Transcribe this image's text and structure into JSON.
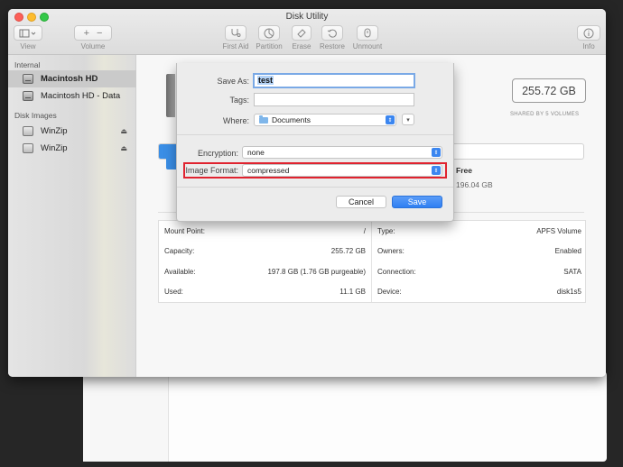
{
  "window": {
    "title": "Disk Utility"
  },
  "toolbar": {
    "view_label": "View",
    "volume_label": "Volume",
    "first_aid_label": "First Aid",
    "partition_label": "Partition",
    "erase_label": "Erase",
    "restore_label": "Restore",
    "unmount_label": "Unmount",
    "info_label": "Info"
  },
  "sidebar": {
    "internal_header": "Internal",
    "disk_images_header": "Disk Images",
    "internal_items": [
      {
        "label": "Macintosh HD",
        "selected": true
      },
      {
        "label": "Macintosh HD - Data",
        "selected": false
      }
    ],
    "disk_image_items": [
      {
        "label": "WinZip",
        "eject": "⏏"
      },
      {
        "label": "WinZip",
        "eject": "⏏"
      }
    ]
  },
  "volume": {
    "size": "255.72 GB",
    "shared_note": "SHARED BY 5 VOLUMES",
    "used_fraction": 0.043,
    "free_label": "Free",
    "free_value": "196.04 GB"
  },
  "info": {
    "left": [
      {
        "key": "Mount Point:",
        "value": "/"
      },
      {
        "key": "Capacity:",
        "value": "255.72 GB"
      },
      {
        "key": "Available:",
        "value": "197.8 GB (1.76 GB purgeable)"
      },
      {
        "key": "Used:",
        "value": "11.1 GB"
      }
    ],
    "right": [
      {
        "key": "Type:",
        "value": "APFS Volume"
      },
      {
        "key": "Owners:",
        "value": "Enabled"
      },
      {
        "key": "Connection:",
        "value": "SATA"
      },
      {
        "key": "Device:",
        "value": "disk1s5"
      }
    ]
  },
  "dialog": {
    "save_as_label": "Save As:",
    "save_as_value": "test",
    "tags_label": "Tags:",
    "tags_value": "",
    "where_label": "Where:",
    "where_value": "Documents",
    "encryption_label": "Encryption:",
    "encryption_value": "none",
    "image_format_label": "Image Format:",
    "image_format_value": "compressed",
    "cancel_label": "Cancel",
    "save_label": "Save"
  },
  "colors": {
    "accent": "#3a8ee6",
    "highlight": "#e0232f"
  }
}
